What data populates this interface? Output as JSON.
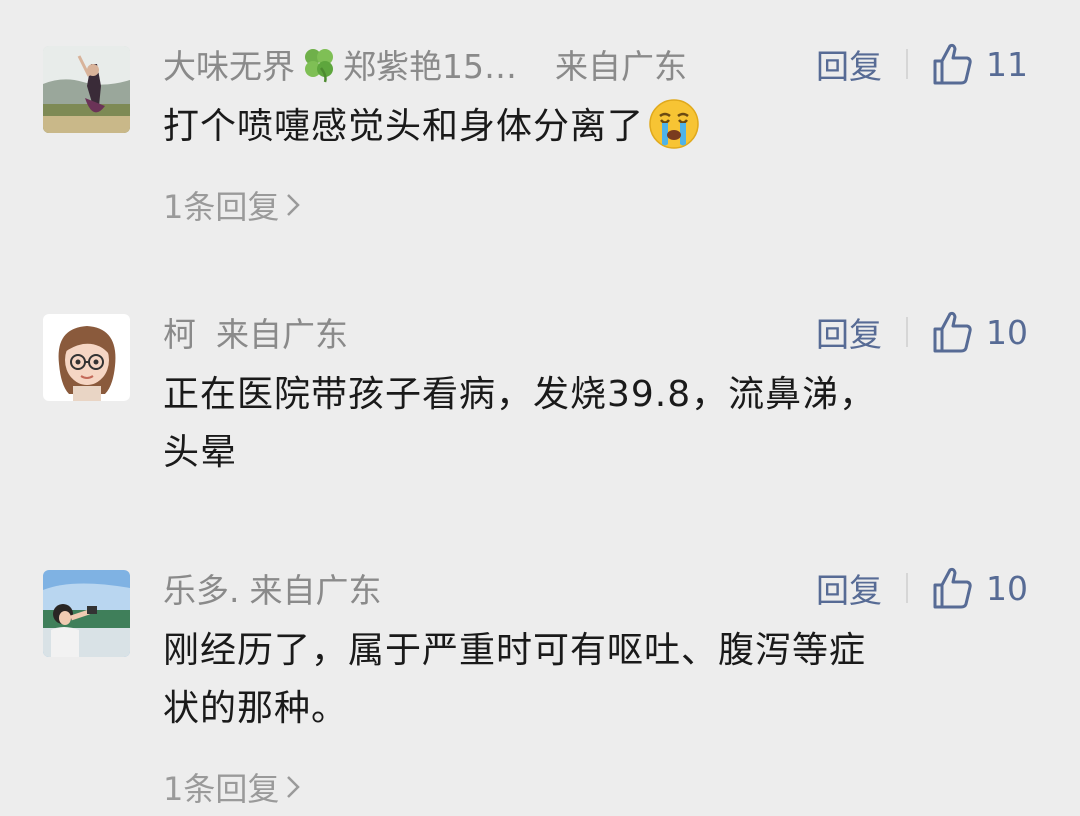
{
  "comments": [
    {
      "nickname_pre": "大味无界",
      "nickname_post": "郑紫艳15…",
      "location": "来自广东",
      "reply_label": "回复",
      "like_count": "11",
      "text": "打个喷嚏感觉头和身体分离了",
      "sub_reply": "1条回复",
      "avatar_icon": "woman-outdoor-photo",
      "emoji_icon": "crying-face-emoji",
      "clover_icon": "four-leaf-clover-icon"
    },
    {
      "nickname": "柯",
      "location": "来自广东",
      "reply_label": "回复",
      "like_count": "10",
      "text_line1": "正在医院带孩子看病，发烧39.8，流鼻涕，",
      "text_line2": "头晕",
      "avatar_icon": "cartoon-girl-glasses"
    },
    {
      "nickname": "乐多.",
      "location": "来自广东",
      "reply_label": "回复",
      "like_count": "10",
      "text_line1": "刚经历了，属于严重时可有呕吐、腹泻等症",
      "text_line2": "状的那种。",
      "sub_reply": "1条回复",
      "avatar_icon": "girl-taking-photo"
    }
  ],
  "colors": {
    "background": "#ededed",
    "link": "#576b95",
    "meta_gray": "#8a8a8a",
    "text": "#1a1a1a"
  }
}
